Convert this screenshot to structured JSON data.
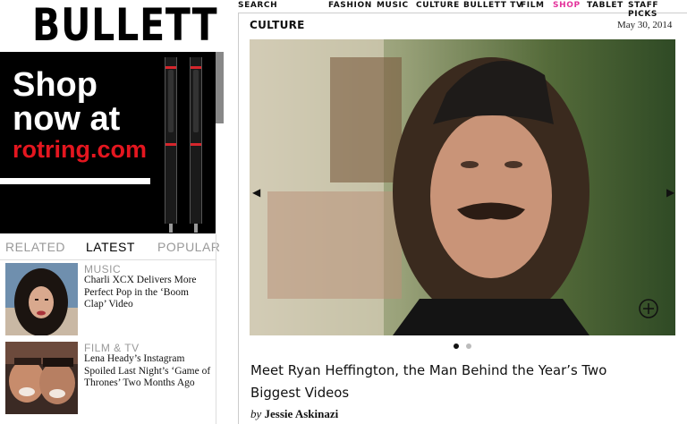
{
  "brand": {
    "logo_text": "BULLETT"
  },
  "ad": {
    "line1": "Shop",
    "line2": "now at",
    "brand_text": "rotring.com",
    "brand_color": "#e4161f"
  },
  "tabs": [
    {
      "label": "RELATED",
      "active": false
    },
    {
      "label": "LATEST",
      "active": true
    },
    {
      "label": "POPULAR",
      "active": false
    }
  ],
  "latest": [
    {
      "category": "MUSIC",
      "title": "Charli XCX Delivers More Perfect Pop in the ‘Boom Clap’ Video"
    },
    {
      "category": "FILM & TV",
      "title": "Lena Heady’s Instagram Spoiled Last Night’s ‘Game of Thrones’ Two Months Ago"
    }
  ],
  "nav": {
    "search": "SEARCH",
    "items": [
      "FASHION",
      "MUSIC",
      "CULTURE",
      "BULLETT TV",
      "FILM",
      "SHOP",
      "TABLET",
      "STAFF PICKS"
    ],
    "highlight": "SHOP",
    "highlight_color": "#e4329b"
  },
  "article": {
    "section": "CULTURE",
    "date": "May 30, 2014",
    "headline": "Meet Ryan Heffington, the Man Behind the Year’s Two Biggest Videos",
    "byline_prefix": "by",
    "author": "Jessie Askinazi",
    "carousel": {
      "total": 2,
      "active": 1
    }
  }
}
